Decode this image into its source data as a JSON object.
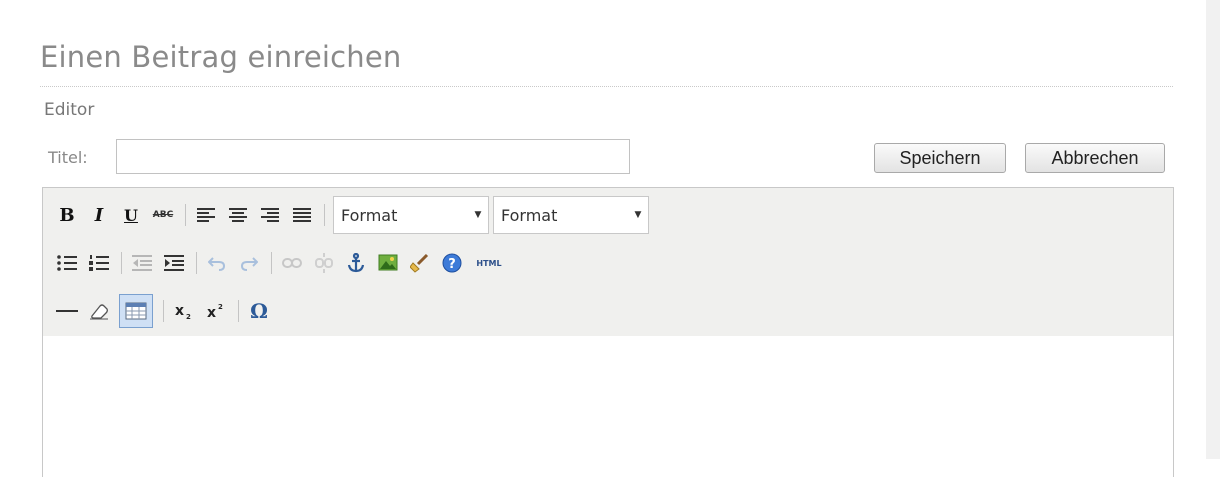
{
  "page": {
    "title": "Einen Beitrag einreichen",
    "section": "Editor"
  },
  "form": {
    "title_label": "Titel:",
    "title_value": ""
  },
  "buttons": {
    "save": "Speichern",
    "cancel": "Abbrechen"
  },
  "toolbar": {
    "format_1": "Format",
    "format_2": "Format",
    "labels": {
      "bold": "B",
      "italic": "I",
      "underline": "U",
      "strike": "ABC",
      "html": "HTML",
      "omega": "Ω"
    },
    "icons": [
      "bold-icon",
      "italic-icon",
      "underline-icon",
      "strikethrough-icon",
      "align-left-icon",
      "align-center-icon",
      "align-right-icon",
      "align-justify-icon",
      "bullet-list-icon",
      "numbered-list-icon",
      "outdent-icon",
      "indent-icon",
      "undo-icon",
      "redo-icon",
      "link-icon",
      "unlink-icon",
      "anchor-icon",
      "image-icon",
      "cleanup-icon",
      "help-icon",
      "html-icon",
      "horizontal-rule-icon",
      "eraser-icon",
      "table-icon",
      "subscript-icon",
      "superscript-icon",
      "special-char-icon"
    ]
  }
}
